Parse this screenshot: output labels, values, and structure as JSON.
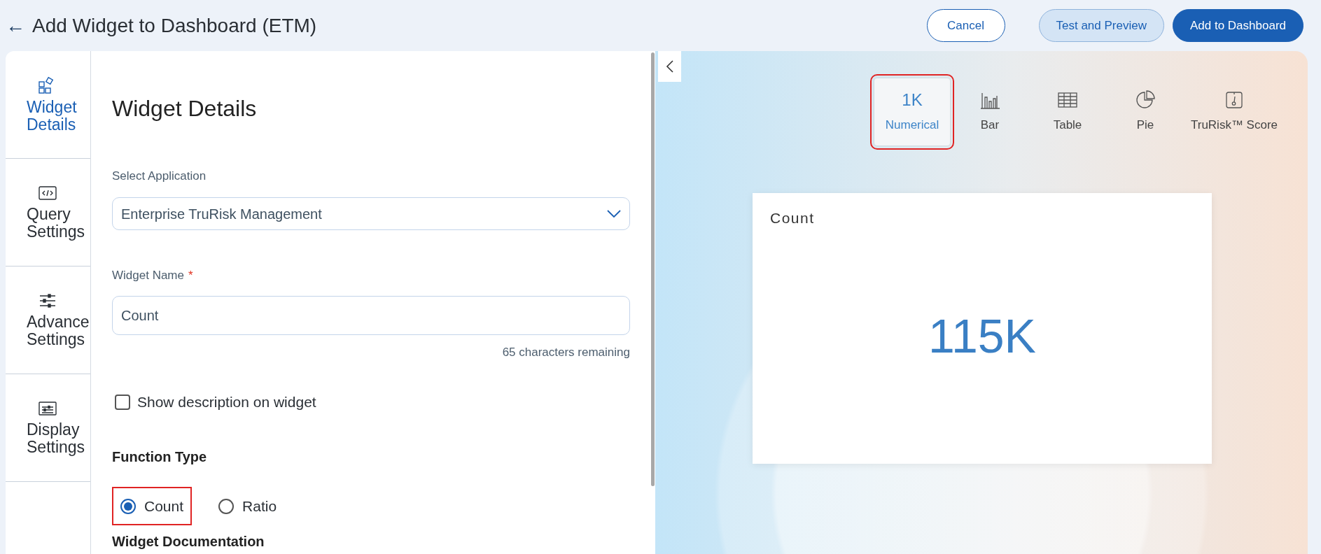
{
  "header": {
    "back": "←",
    "title": "Add Widget to Dashboard (ETM)",
    "buttons": [
      {
        "label": "Cancel",
        "kind": "outline"
      },
      {
        "label": "Test and Preview",
        "kind": "soft"
      },
      {
        "label": "Add to Dashboard",
        "kind": "primary"
      }
    ]
  },
  "nav": [
    {
      "label": "Widget Details",
      "kind": "widgets",
      "selected": true
    },
    {
      "label": "Query Settings",
      "kind": "code",
      "selected": false
    },
    {
      "label": "Advance Settings",
      "kind": "sliders",
      "selected": false
    },
    {
      "label": "Display Settings",
      "kind": "display",
      "selected": false
    }
  ],
  "form": {
    "heading": "Widget Details",
    "application": {
      "label": "Select Application",
      "value": "Enterprise TruRisk Management"
    },
    "widget_name": {
      "label": "Widget Name",
      "required_mark": "*",
      "value": "Count",
      "hint": "65 characters remaining"
    },
    "show_description": {
      "label": "Show description on widget",
      "checked": false
    },
    "function_type": {
      "label": "Function Type",
      "options": [
        {
          "label": "Count",
          "selected": true,
          "highlighted": true
        },
        {
          "label": "Ratio",
          "selected": false,
          "highlighted": false
        }
      ]
    },
    "next_section": "Widget Documentation"
  },
  "preview": {
    "chart_types": [
      {
        "label": "Numerical",
        "glyph": "1K",
        "kind": "numerical",
        "selected": true,
        "highlighted": true
      },
      {
        "label": "Bar",
        "kind": "bar",
        "selected": false,
        "highlighted": false
      },
      {
        "label": "Table",
        "kind": "table",
        "selected": false,
        "highlighted": false
      },
      {
        "label": "Pie",
        "kind": "pie",
        "selected": false,
        "highlighted": false
      },
      {
        "label": "TruRisk™ Score",
        "kind": "score",
        "selected": false,
        "highlighted": false
      }
    ],
    "card": {
      "title": "Count",
      "value": "115K"
    }
  }
}
